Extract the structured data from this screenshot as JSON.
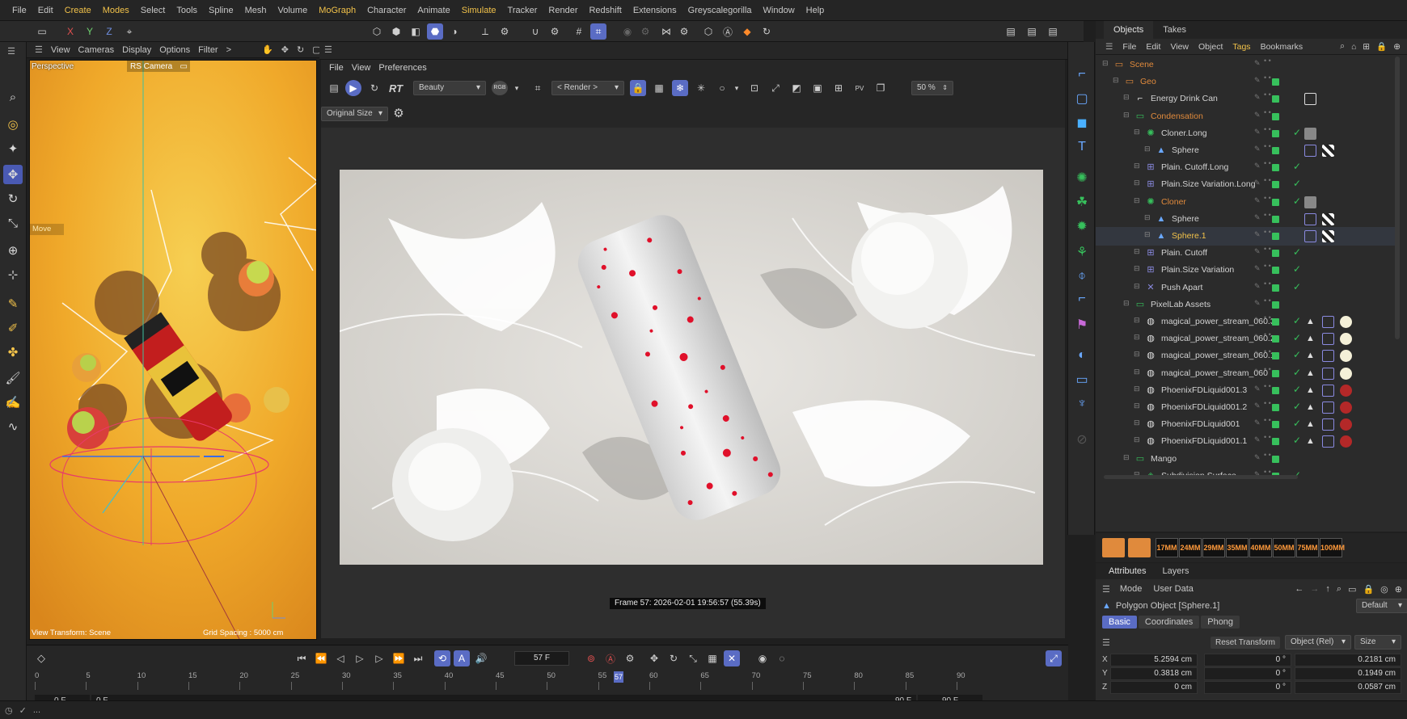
{
  "menubar": [
    "File",
    "Edit",
    "Create",
    "Modes",
    "Select",
    "Tools",
    "Spline",
    "Mesh",
    "Volume",
    "MoGraph",
    "Character",
    "Animate",
    "Simulate",
    "Tracker",
    "Render",
    "Redshift",
    "Extensions",
    "Greyscalegorilla",
    "Window",
    "Help"
  ],
  "menubar_highlight": [
    "Create",
    "Modes",
    "MoGraph",
    "Simulate"
  ],
  "axes": {
    "x": "X",
    "y": "Y",
    "z": "Z"
  },
  "viewport": {
    "menu": [
      "View",
      "Cameras",
      "Display",
      "Options",
      "Filter"
    ],
    "more": ">",
    "name": "Perspective",
    "camera": "RS Camera",
    "tool": "Move",
    "view_transform": "View Transform: Scene",
    "grid_spacing": "Grid Spacing : 5000 cm"
  },
  "render_view": {
    "menu": [
      "File",
      "View",
      "Preferences"
    ],
    "rt_label": "RT",
    "aov": "Beauty",
    "render_select": "< Render >",
    "rgb_label": "RGB",
    "zoom": "50 %",
    "size": "Original Size",
    "frame_info": "Frame  57:  2026-02-01  19:56:57  (55.39s)"
  },
  "timeline": {
    "current_frame": "57 F",
    "ticks": [
      "0",
      "5",
      "10",
      "15",
      "20",
      "25",
      "30",
      "35",
      "40",
      "45",
      "50",
      "55",
      "60",
      "65",
      "70",
      "75",
      "80",
      "85",
      "90"
    ],
    "playhead_label": "57",
    "playhead_value": 57,
    "max_value": 90,
    "start": "0 F",
    "start2": "0 F",
    "end": "90 F",
    "end2": "90 F"
  },
  "objects": {
    "tabs": [
      "Objects",
      "Takes"
    ],
    "menu": [
      "File",
      "Edit",
      "View",
      "Object",
      "Tags",
      "Bookmarks"
    ],
    "rows": [
      {
        "name": "Scene",
        "indent": 0,
        "color": "#e08a3c",
        "icon": "folder-icon",
        "check": false
      },
      {
        "name": "Geo",
        "indent": 1,
        "color": "#e08a3c",
        "icon": "folder-icon",
        "check": false
      },
      {
        "name": "Energy Drink Can",
        "indent": 2,
        "color": "#d2d2d2",
        "icon": "null-icon",
        "check": false
      },
      {
        "name": "Condensation",
        "indent": 2,
        "color": "#e08a3c",
        "icon": "folder-icon",
        "check": false
      },
      {
        "name": "Cloner.Long",
        "indent": 3,
        "color": "#d2d2d2",
        "icon": "cloner-icon",
        "check": true
      },
      {
        "name": "Sphere",
        "indent": 4,
        "color": "#d2d2d2",
        "icon": "sphere-icon",
        "check": false
      },
      {
        "name": "Plain. Cutoff.Long",
        "indent": 3,
        "color": "#d2d2d2",
        "icon": "effector-icon",
        "check": true
      },
      {
        "name": "Plain.Size Variation.Long",
        "indent": 3,
        "color": "#d2d2d2",
        "icon": "effector-icon",
        "check": true
      },
      {
        "name": "Cloner",
        "indent": 3,
        "color": "#e08a3c",
        "icon": "cloner-icon",
        "check": true
      },
      {
        "name": "Sphere",
        "indent": 4,
        "color": "#d2d2d2",
        "icon": "sphere-icon",
        "check": false
      },
      {
        "name": "Sphere.1",
        "indent": 4,
        "color": "#f2c24a",
        "icon": "sphere-icon",
        "check": false
      },
      {
        "name": "Plain. Cutoff",
        "indent": 3,
        "color": "#d2d2d2",
        "icon": "effector-icon",
        "check": true
      },
      {
        "name": "Plain.Size Variation",
        "indent": 3,
        "color": "#d2d2d2",
        "icon": "effector-icon",
        "check": true
      },
      {
        "name": "Push Apart",
        "indent": 3,
        "color": "#d2d2d2",
        "icon": "push-apart-icon",
        "check": true
      },
      {
        "name": "PixelLab Assets",
        "indent": 2,
        "color": "#d2d2d2",
        "icon": "folder-icon",
        "check": false
      },
      {
        "name": "magical_power_stream_060.3",
        "indent": 3,
        "color": "#d2d2d2",
        "icon": "alembic-icon",
        "check": true
      },
      {
        "name": "magical_power_stream_060.2",
        "indent": 3,
        "color": "#d2d2d2",
        "icon": "alembic-icon",
        "check": true
      },
      {
        "name": "magical_power_stream_060.1",
        "indent": 3,
        "color": "#d2d2d2",
        "icon": "alembic-icon",
        "check": true
      },
      {
        "name": "magical_power_stream_060",
        "indent": 3,
        "color": "#d2d2d2",
        "icon": "alembic-icon",
        "check": true
      },
      {
        "name": "PhoenixFDLiquid001.3",
        "indent": 3,
        "color": "#d2d2d2",
        "icon": "alembic-icon",
        "check": true
      },
      {
        "name": "PhoenixFDLiquid001.2",
        "indent": 3,
        "color": "#d2d2d2",
        "icon": "alembic-icon",
        "check": true
      },
      {
        "name": "PhoenixFDLiquid001",
        "indent": 3,
        "color": "#d2d2d2",
        "icon": "alembic-icon",
        "check": true
      },
      {
        "name": "PhoenixFDLiquid001.1",
        "indent": 3,
        "color": "#d2d2d2",
        "icon": "alembic-icon",
        "check": true
      },
      {
        "name": "Mango",
        "indent": 2,
        "color": "#d2d2d2",
        "icon": "folder-icon",
        "check": false
      },
      {
        "name": "Subdivision Surface",
        "indent": 3,
        "color": "#d2d2d2",
        "icon": "subdivision-icon",
        "check": true
      }
    ]
  },
  "lenses": [
    "17MM",
    "24MM",
    "29MM",
    "35MM",
    "40MM",
    "50MM",
    "75MM",
    "100MM"
  ],
  "attributes": {
    "tabs": [
      "Attributes",
      "Layers"
    ],
    "menu": [
      "Mode",
      "User Data"
    ],
    "object": "Polygon Object [Sphere.1]",
    "preset": "Default",
    "subtabs": [
      "Basic",
      "Coordinates",
      "Phong"
    ],
    "reset": "Reset Transform",
    "space": "Object (Rel)",
    "mode": "Size",
    "coords": [
      {
        "axis": "X",
        "pos": "5.2594 cm",
        "rot": "0 °",
        "size": "0.2181 cm"
      },
      {
        "axis": "Y",
        "pos": "0.3818 cm",
        "rot": "0 °",
        "size": "0.1949 cm"
      },
      {
        "axis": "Z",
        "pos": "0 cm",
        "rot": "0 °",
        "size": "0.0587 cm"
      }
    ]
  },
  "status": {
    "text": "..."
  }
}
